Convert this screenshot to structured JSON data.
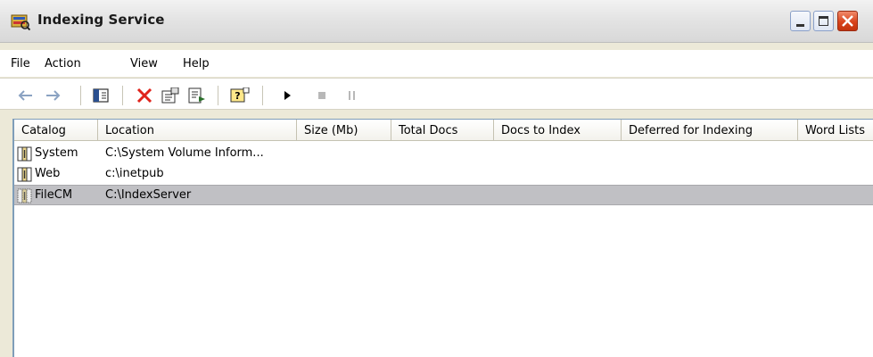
{
  "window": {
    "title": "Indexing Service",
    "icon": "indexing-service-icon"
  },
  "titlebar_buttons": {
    "minimize": "minimize-icon",
    "maximize": "maximize-icon",
    "close": "close-icon"
  },
  "menu": {
    "file": "File",
    "action": "Action",
    "view": "View",
    "help": "Help"
  },
  "toolbar": {
    "back": "back-arrow-icon",
    "forward": "forward-arrow-icon",
    "show_hide_tree": "show-hide-console-tree-icon",
    "delete": "delete-icon",
    "properties": "properties-icon",
    "export": "export-list-icon",
    "help": "help-icon",
    "start": "start-service-icon",
    "stop": "stop-service-icon",
    "pause": "pause-service-icon"
  },
  "columns": [
    "Catalog",
    "Location",
    "Size (Mb)",
    "Total Docs",
    "Docs to Index",
    "Deferred for Indexing",
    "Word Lists"
  ],
  "rows": [
    {
      "catalog": "System",
      "location": "C:\\System Volume Inform...",
      "selected": false
    },
    {
      "catalog": "Web",
      "location": "c:\\inetpub",
      "selected": false
    },
    {
      "catalog": "FileCM",
      "location": "C:\\IndexServer",
      "selected": true
    }
  ],
  "colors": {
    "selection": "#c0c0c4",
    "delete_red": "#e0231b"
  }
}
